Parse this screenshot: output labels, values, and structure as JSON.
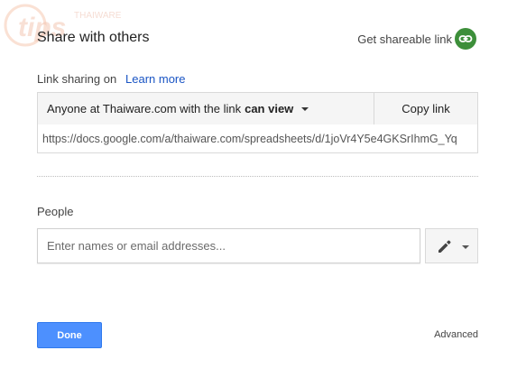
{
  "watermark": {
    "text": "THAIWARE"
  },
  "dialog": {
    "title": "Share with others",
    "get_shareable_link": "Get shareable link",
    "link_icon": "link-icon"
  },
  "link_sharing": {
    "label": "Link sharing on",
    "learn_more": "Learn more",
    "access_prefix": "Anyone at Thaiware.com with the link",
    "access_level": "can view",
    "copy_label": "Copy link",
    "url": "https://docs.google.com/a/thaiware.com/spreadsheets/d/1joVr4Y5e4GKSrIhmG_Yq"
  },
  "people": {
    "label": "People",
    "placeholder": "Enter names or email addresses...",
    "edit_icon": "pencil-icon"
  },
  "footer": {
    "done_label": "Done",
    "advanced_label": "Advanced"
  },
  "colors": {
    "accent": "#4d90fe",
    "link_green": "#3d8f3a",
    "link_blue": "#1a55c4"
  }
}
